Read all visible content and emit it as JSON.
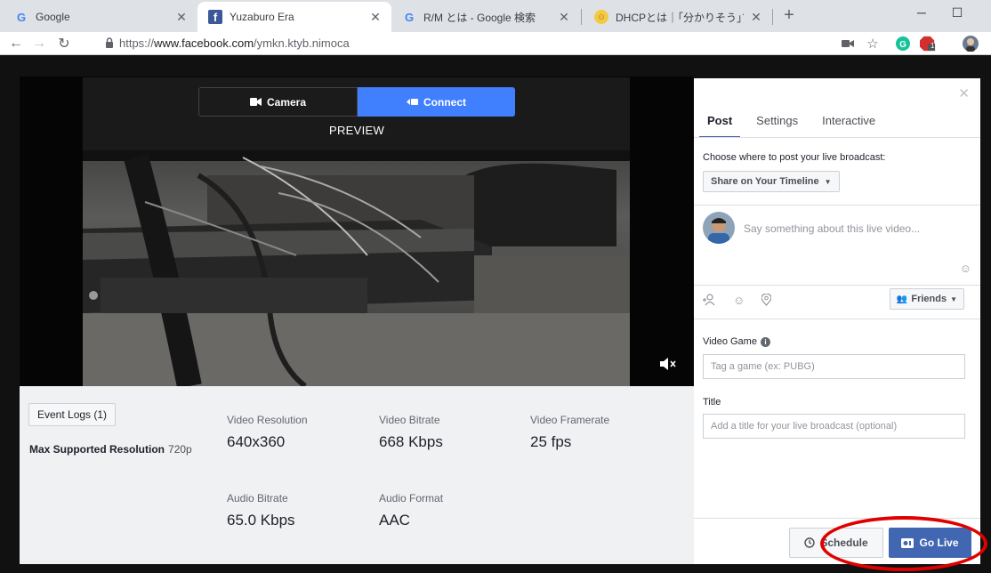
{
  "browser": {
    "tabs": [
      {
        "title": "Google",
        "favicon": "google-g-icon"
      },
      {
        "title": "Yuzaburo Era",
        "favicon": "facebook-icon"
      },
      {
        "title": "R/M とは - Google 検索",
        "favicon": "google-g-icon"
      },
      {
        "title": "DHCPとは｜｢分かりそう｣で｢分から",
        "favicon": "smiley-icon"
      }
    ],
    "url_prefix": "https://",
    "url_host": "www.facebook.com",
    "url_path": "/ymkn.ktyb.nimoca",
    "ext_badge": "1"
  },
  "preview": {
    "camera_label": "Camera",
    "connect_label": "Connect",
    "preview_label": "PREVIEW"
  },
  "stats": {
    "event_logs": "Event Logs (1)",
    "max_res_label": "Max Supported Resolution",
    "max_res_value": "720p",
    "video_resolution_label": "Video Resolution",
    "video_resolution": "640x360",
    "video_bitrate_label": "Video Bitrate",
    "video_bitrate": "668 Kbps",
    "video_framerate_label": "Video Framerate",
    "video_framerate": "25 fps",
    "audio_bitrate_label": "Audio Bitrate",
    "audio_bitrate": "65.0 Kbps",
    "audio_format_label": "Audio Format",
    "audio_format": "AAC"
  },
  "panel": {
    "tabs": [
      "Post",
      "Settings",
      "Interactive"
    ],
    "choose_label": "Choose where to post your live broadcast:",
    "share_target": "Share on Your Timeline",
    "status_placeholder": "Say something about this live video...",
    "audience": "Friends",
    "video_game_label": "Video Game",
    "video_game_placeholder": "Tag a game (ex: PUBG)",
    "title_label": "Title",
    "title_placeholder": "Add a title for your live broadcast (optional)",
    "schedule_label": "Schedule",
    "golive_label": "Go Live"
  },
  "colors": {
    "accent": "#4080ff",
    "brand": "#4267b2",
    "annotation": "#e00000"
  }
}
